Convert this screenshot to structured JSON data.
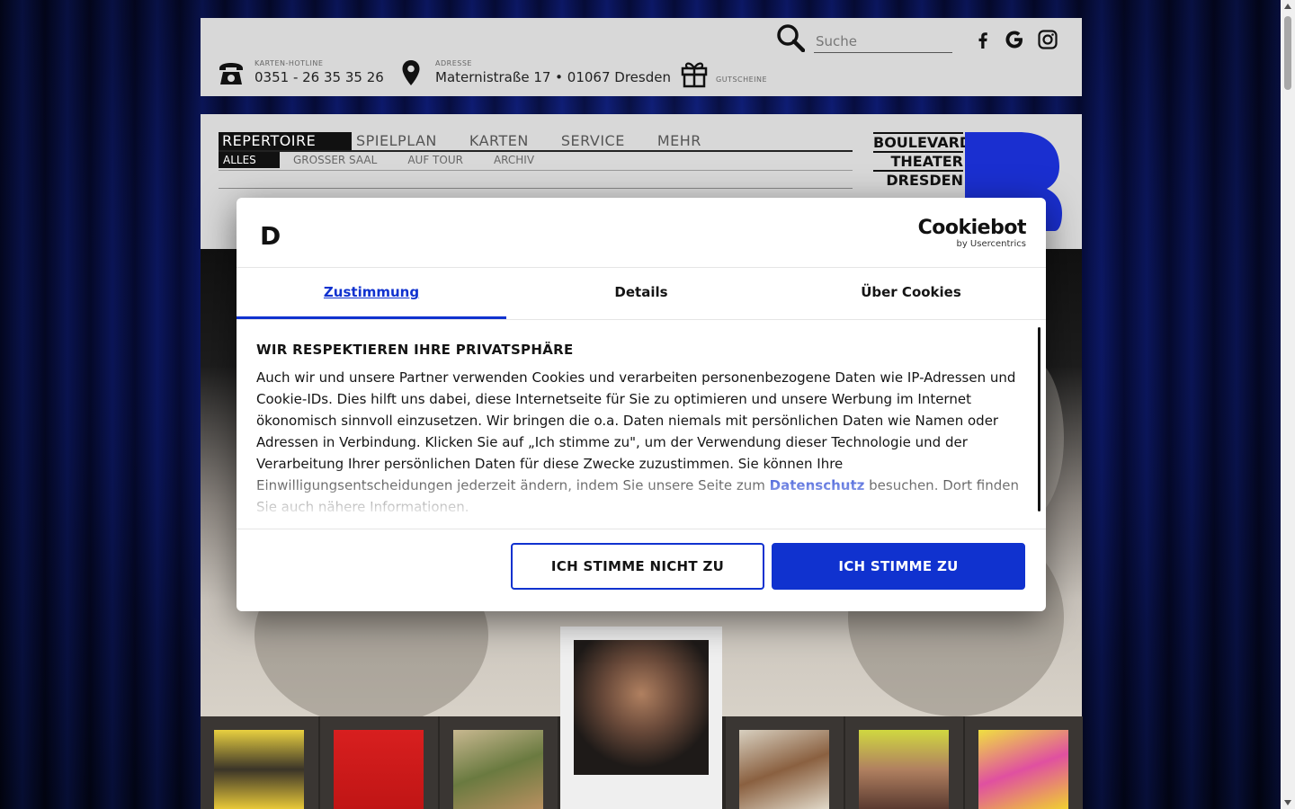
{
  "search": {
    "placeholder": "Suche"
  },
  "contacts": {
    "hotline_label": "KARTEN-HOTLINE",
    "hotline_value": "0351 - 26 35 35 26",
    "address_label": "ADRESSE",
    "address_value": "Maternistraße 17 • 01067 Dresden",
    "vouchers_label": "GUTSCHEINE"
  },
  "social": [
    "facebook-icon",
    "google-icon",
    "instagram-icon"
  ],
  "nav": {
    "main": [
      "REPERTOIRE",
      "SPIELPLAN",
      "KARTEN",
      "SERVICE",
      "MEHR"
    ],
    "sub": [
      "ALLES",
      "GROSSER SAAL",
      "AUF TOUR",
      "ARCHIV"
    ]
  },
  "logo": {
    "line1": "BOULEVARD",
    "line2": "THEATER",
    "line3": "DRESDEN"
  },
  "dialog": {
    "logo_letter": "D",
    "brand_name": "Cookiebot",
    "brand_by": "by Usercentrics",
    "tabs": [
      "Zustimmung",
      "Details",
      "Über Cookies"
    ],
    "heading": "WIR RESPEKTIEREN IHRE PRIVATSPHÄRE",
    "text": "Auch wir und unsere Partner verwenden Cookies und verarbeiten personenbezogene Daten wie IP-Adressen und Cookie-IDs. Dies hilft uns dabei, diese Internetseite für Sie zu optimieren und unsere Werbung im Internet ökonomisch sinnvoll einzusetzen. Wir bringen die o.a. Daten niemals mit persönlichen Daten wie Namen oder Adressen in Verbindung. Klicken Sie auf „Ich stimme zu\", um der Verwendung dieser Technologie und der Verarbeitung Ihrer persönlichen Daten für diese Zwecke zuzustimmen. Sie können Ihre Einwilligungsentscheidungen jederzeit ändern, indem Sie unsere Seite zum ",
    "link": "Datenschutz",
    "text_end": " besuchen. Dort finden Sie auch nähere Informationen.",
    "deny_label": "ICH STIMME NICHT ZU",
    "allow_label": "ICH STIMME ZU"
  },
  "colors": {
    "accent": "#1032cf",
    "logo_blue": "#1a2fd0"
  }
}
